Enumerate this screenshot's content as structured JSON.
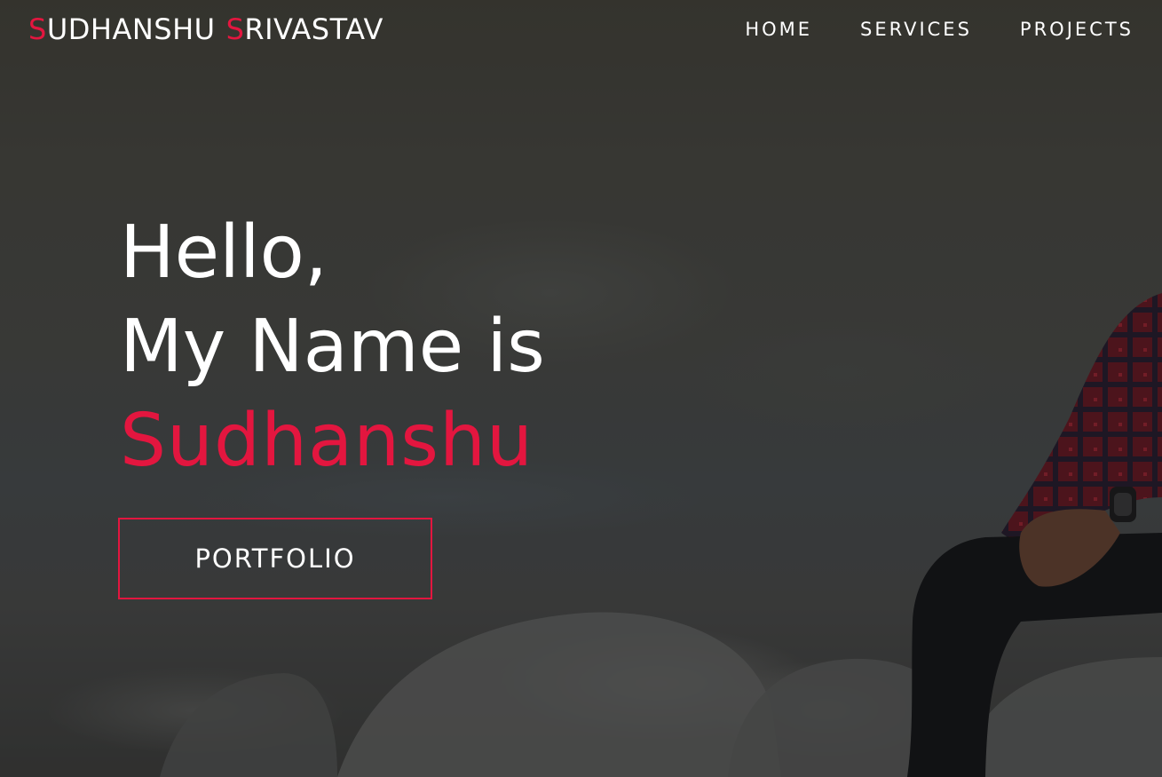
{
  "brand": {
    "first_initial": "S",
    "first_rest": "UDHANSHU",
    "last_initial": "S",
    "last_rest": "RIVASTAV",
    "accent_color": "#e3163f"
  },
  "nav": {
    "items": [
      {
        "label": "HOME"
      },
      {
        "label": "SERVICES"
      },
      {
        "label": "PROJECTS"
      }
    ]
  },
  "hero": {
    "line1": "Hello,",
    "line2": "My Name is",
    "name": "Sudhanshu",
    "button_label": "PORTFOLIO",
    "background": "photo of a man in a red plaid shirt sitting on river rocks"
  },
  "colors": {
    "accent": "#e3163f",
    "text": "#ffffff"
  }
}
